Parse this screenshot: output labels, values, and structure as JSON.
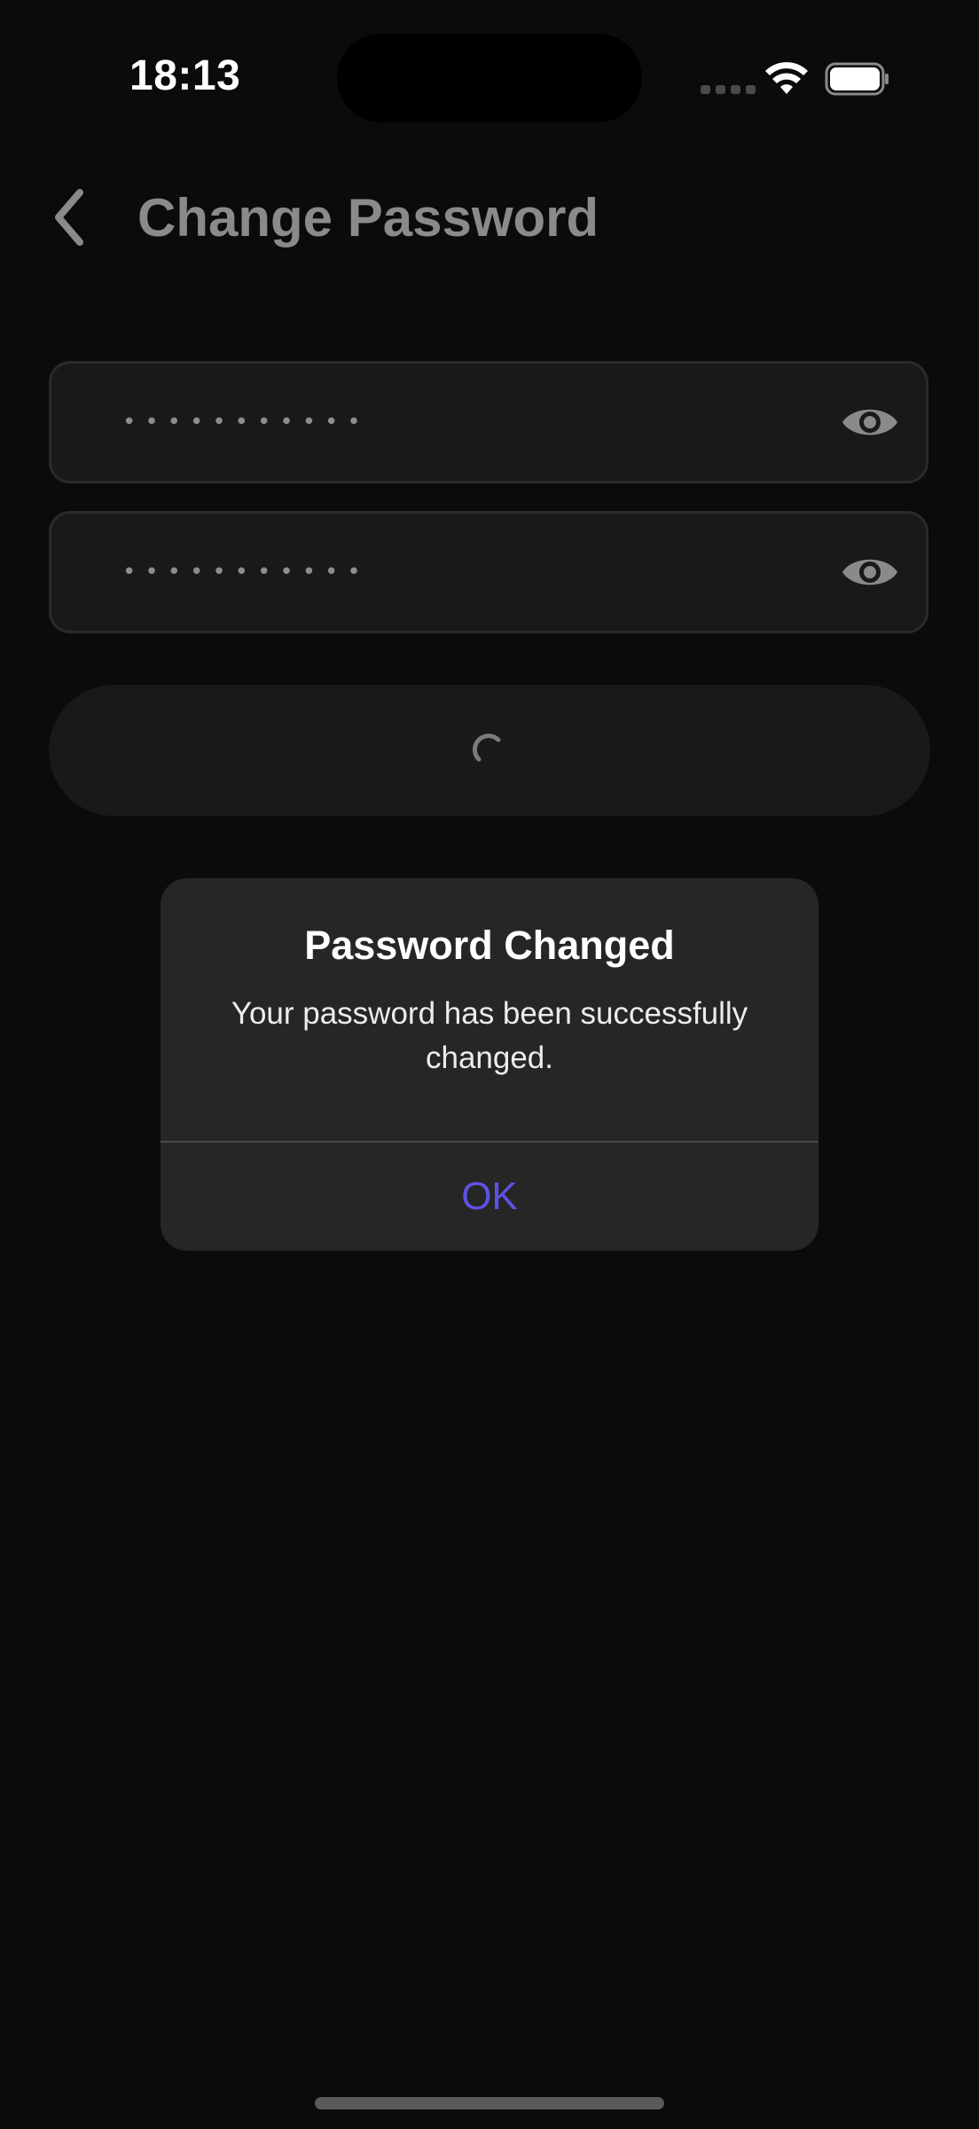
{
  "status_bar": {
    "time": "18:13"
  },
  "header": {
    "title": "Change Password",
    "back_icon": "chevron-left-icon"
  },
  "form": {
    "field_1": {
      "masked_value": "•••••••••••",
      "toggle_icon": "eye-icon"
    },
    "field_2": {
      "masked_value": "•••••••••••",
      "toggle_icon": "eye-icon"
    },
    "submit": {
      "state": "loading"
    }
  },
  "alert": {
    "title": "Password Changed",
    "message": "Your password has been successfully changed.",
    "ok_label": "OK"
  },
  "colors": {
    "background": "#0b0b0b",
    "field_bg": "#191919",
    "alert_bg": "#262626",
    "accent": "#5e52e6",
    "title_text": "#8a8a8a"
  }
}
